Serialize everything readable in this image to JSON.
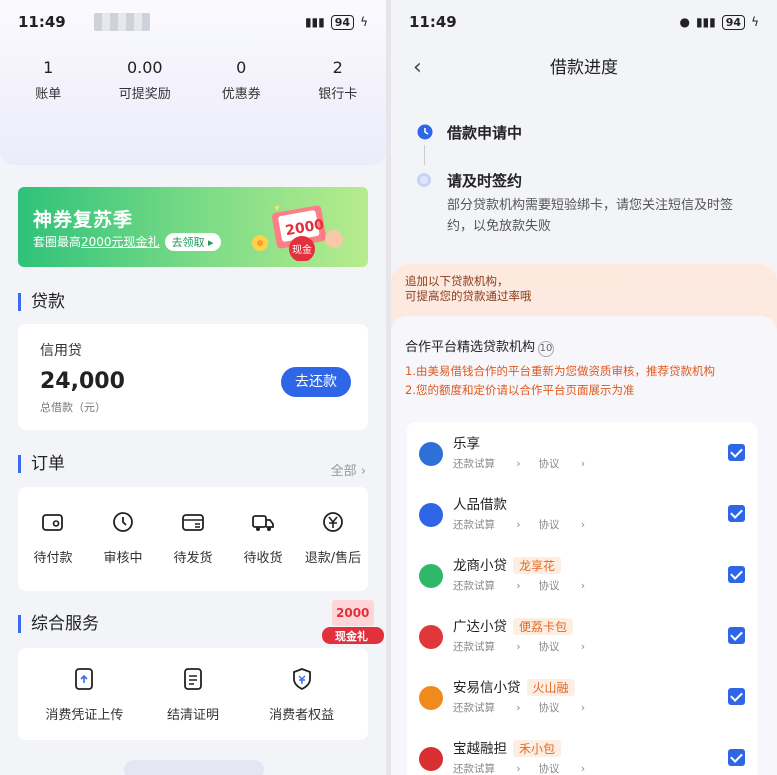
{
  "left": {
    "status": {
      "time": "11:49",
      "battery": "94"
    },
    "stats": [
      {
        "value": "1",
        "label": "账单"
      },
      {
        "value": "0.00",
        "label": "可提奖励"
      },
      {
        "value": "0",
        "label": "优惠券"
      },
      {
        "value": "2",
        "label": "银行卡"
      }
    ],
    "banner": {
      "title": "神券复苏季",
      "sub_prefix": "套圈最高",
      "sub_amount": "2000元现金礼",
      "cta": "去领取",
      "gift_amount": "2000",
      "gift_label": "现金"
    },
    "loan": {
      "section": "贷款",
      "product": "信用贷",
      "amount": "24,000",
      "amount_label": "总借款（元）",
      "repay": "去还款"
    },
    "orders": {
      "section": "订单",
      "all": "全部",
      "items": [
        "待付款",
        "审核中",
        "待发货",
        "待收货",
        "退款/售后"
      ]
    },
    "services": {
      "section": "综合服务",
      "items": [
        "消费凭证上传",
        "结清证明",
        "消费者权益"
      ]
    },
    "floating": {
      "amount": "2000",
      "label": "现金礼"
    }
  },
  "right": {
    "status": {
      "time": "11:49",
      "battery": "94"
    },
    "title": "借款进度",
    "steps": [
      {
        "label": "借款申请中"
      },
      {
        "label": "请及时签约",
        "desc": "部分贷款机构需要短验绑卡，请您关注短信及时签约，以免放款失败"
      }
    ],
    "tip": {
      "line1": "追加以下贷款机构，",
      "line2": "可提高您的贷款通过率哦"
    },
    "panel": {
      "title": "合作平台精选贷款机构",
      "count": "10",
      "note1": "1.由美易借钱合作的平台重新为您做资质审核，推荐贷款机构",
      "note2": "2.您的额度和定价请以合作平台页面展示为准"
    },
    "lenders": [
      {
        "name": "乐享",
        "tag": "",
        "calc": "还款试算",
        "agreement": "协议",
        "color": "#2f6fd8"
      },
      {
        "name": "人品借款",
        "tag": "",
        "calc": "还款试算",
        "agreement": "协议",
        "color": "#2f66e8"
      },
      {
        "name": "龙商小贷",
        "tag": "龙享花",
        "calc": "还款试算",
        "agreement": "协议",
        "color": "#2fb86a"
      },
      {
        "name": "广达小贷",
        "tag": "便荔卡包",
        "calc": "还款试算",
        "agreement": "协议",
        "color": "#e0383a"
      },
      {
        "name": "安易信小贷",
        "tag": "火山融",
        "calc": "还款试算",
        "agreement": "协议",
        "color": "#f08a1c"
      },
      {
        "name": "宝越融担",
        "tag": "禾小包",
        "calc": "还款试算",
        "agreement": "协议",
        "color": "#d83030"
      }
    ]
  }
}
